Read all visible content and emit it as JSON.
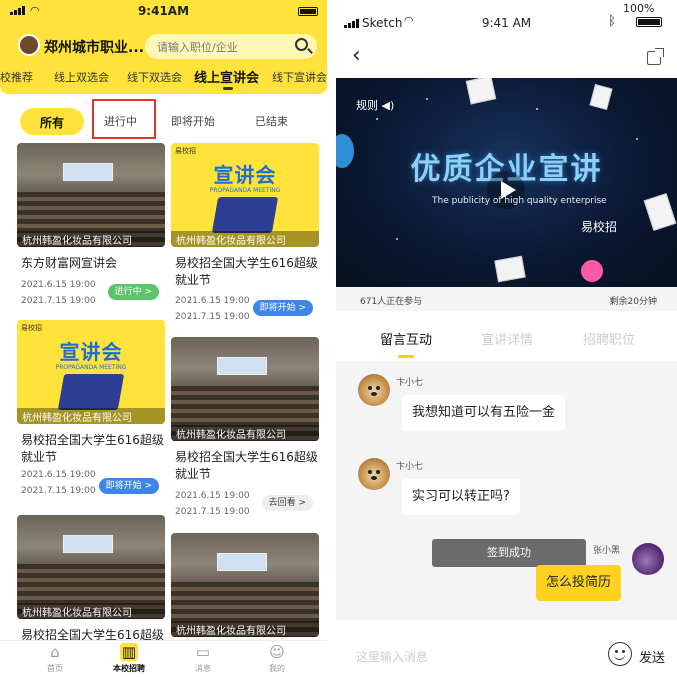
{
  "left": {
    "status": {
      "time": "9:41AM"
    },
    "header": {
      "school_name": "郑州城市职业...",
      "search_placeholder": "请输入职位/企业",
      "tabs": [
        {
          "label": "校推荐"
        },
        {
          "label": "线上双选会"
        },
        {
          "label": "线下双选会"
        },
        {
          "label": "线上宣讲会",
          "active": true
        },
        {
          "label": "线下宣讲会"
        }
      ]
    },
    "filters": [
      {
        "label": "所有",
        "active": true
      },
      {
        "label": "进行中",
        "highlighted": true
      },
      {
        "label": "即将开始"
      },
      {
        "label": "已结束"
      }
    ],
    "cards": [
      {
        "company": "杭州韩盈化妆品有限公司",
        "title": "东方财富网宣讲会",
        "start": "2021.6.15  19:00",
        "end": "2021.7.15  19:00",
        "badge": "进行中 >",
        "badge_color": "#5cc36a"
      },
      {
        "company": "杭州韩盈化妆品有限公司",
        "title": "易校招全国大学生616超级就业节",
        "start": "2021.6.15  19:00",
        "end": "2021.7.15  19:00",
        "badge": "即将开始 >",
        "badge_color": "#3e86e6",
        "poster_title": "宣讲会",
        "poster_sub": "PROPAGANDA MEETING",
        "poster_logo": "易校招"
      },
      {
        "company": "杭州韩盈化妆品有限公司",
        "title": "易校招全国大学生616超级就业节",
        "start": "2021.6.15  19:00",
        "end": "2021.7.15  19:00",
        "badge": "即将开始 >",
        "badge_color": "#3e86e6",
        "poster_title": "宣讲会",
        "poster_sub": "PROPAGANDA MEETING",
        "poster_logo": "易校招"
      },
      {
        "company": "杭州韩盈化妆品有限公司",
        "title": "易校招全国大学生616超级就业节",
        "start": "2021.6.15  19:00",
        "end": "2021.7.15  19:00",
        "badge": "去回看 >",
        "badge_color": "#eeeeee"
      },
      {
        "company": "杭州韩盈化妆品有限公司",
        "title": "易校招全国大学生616超级"
      },
      {
        "company": "杭州韩盈化妆品有限公司"
      }
    ],
    "bottom_nav": [
      {
        "label": "首页",
        "icon": "home-icon"
      },
      {
        "label": "本校招聘",
        "icon": "building-icon",
        "active": true
      },
      {
        "label": "消息",
        "icon": "message-icon"
      },
      {
        "label": "我的",
        "icon": "profile-icon"
      }
    ],
    "accent": "#ffe33a"
  },
  "right": {
    "status": {
      "carrier": "Sketch",
      "time": "9:41 AM",
      "battery": "100%"
    },
    "video": {
      "rule_label": "规则",
      "title": "优质企业宣讲",
      "subtitle": "The publicity of high quality enterprise",
      "brand": "易校招"
    },
    "info": {
      "viewers": "671人正在参与",
      "remaining": "剩余20分钟"
    },
    "tabs": [
      {
        "label": "留言互动",
        "active": true
      },
      {
        "label": "宣讲详情"
      },
      {
        "label": "招聘职位"
      }
    ],
    "messages": [
      {
        "user": "卞小七",
        "text": "我想知道可以有五险一金"
      },
      {
        "user": "卞小七",
        "text": "实习可以转正吗?"
      },
      {
        "user": "张小黑",
        "text": "怎么投简历",
        "mine": true
      }
    ],
    "toast": "签到成功",
    "input": {
      "placeholder": "这里输入消息",
      "send_label": "发送"
    },
    "accent": "#ffd21f"
  }
}
